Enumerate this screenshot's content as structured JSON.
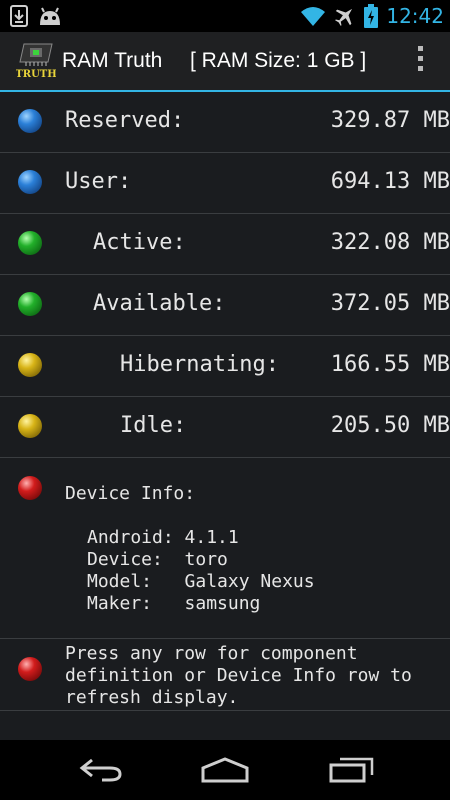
{
  "status_bar": {
    "time": "12:42",
    "icons": [
      "download-icon",
      "android-icon",
      "wifi-icon",
      "airplane-icon",
      "battery-icon"
    ]
  },
  "action_bar": {
    "app_icon_text": "TRUTH",
    "title": "RAM Truth",
    "ram_size": "[ RAM Size: 1 GB ]",
    "overflow_icon": "overflow-menu-icon"
  },
  "rows": [
    {
      "label": "Reserved:",
      "value": "329.87 MB",
      "color": "blue"
    },
    {
      "label": "User:",
      "value": "694.13 MB",
      "color": "blue"
    },
    {
      "label": "Active:",
      "value": "322.08 MB",
      "color": "green"
    },
    {
      "label": "Available:",
      "value": "372.05 MB",
      "color": "green"
    },
    {
      "label": "Hibernating:",
      "value": "166.55 MB",
      "color": "yellow"
    },
    {
      "label": "Idle:",
      "value": "205.50 MB",
      "color": "yellow"
    }
  ],
  "device_info": {
    "title": "Device Info:",
    "lines": [
      "Android: 4.1.1",
      "Device:  toro",
      "Model:   Galaxy Nexus",
      "Maker:   samsung"
    ]
  },
  "hint": {
    "lines": [
      "Press any row for component",
      "definition or Device Info row to",
      "refresh display."
    ]
  },
  "colors": {
    "accent": "#33b5e5",
    "background": "#1a1c1f",
    "action_bar": "#1f2022"
  },
  "nav_bar": {
    "icons": [
      "back-icon",
      "home-icon",
      "recent-apps-icon"
    ]
  }
}
